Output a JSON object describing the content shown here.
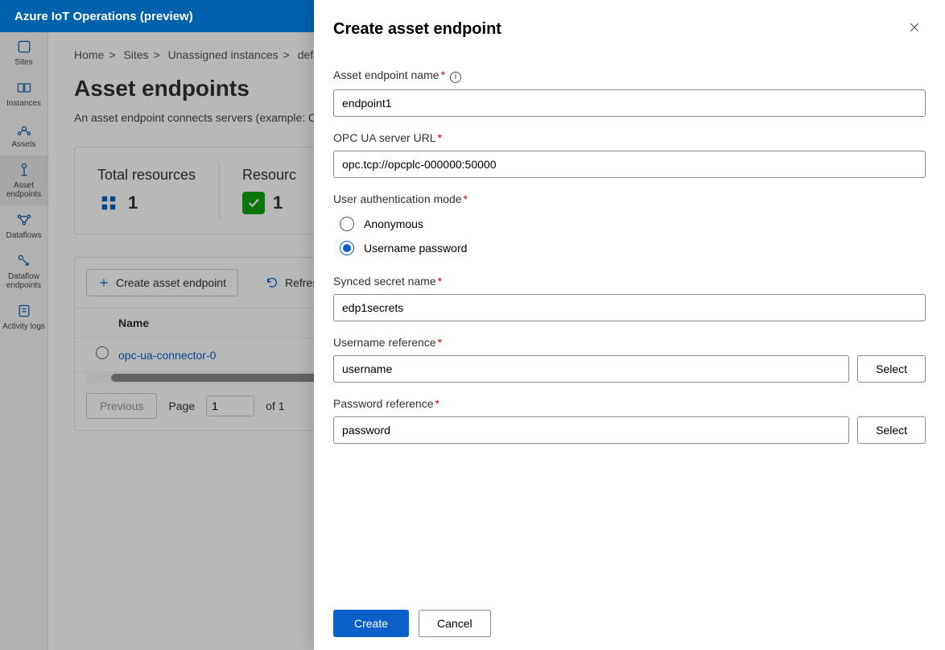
{
  "brand": "Azure IoT Operations (preview)",
  "rail": [
    {
      "id": "sites",
      "label": "Sites"
    },
    {
      "id": "instances",
      "label": "Instances"
    },
    {
      "id": "assets",
      "label": "Assets"
    },
    {
      "id": "asset-endpoints",
      "label": "Asset endpoints"
    },
    {
      "id": "dataflows",
      "label": "Dataflows"
    },
    {
      "id": "dataflow-endpoints",
      "label": "Dataflow endpoints"
    },
    {
      "id": "activity-logs",
      "label": "Activity logs"
    }
  ],
  "crumbs": [
    "Home",
    "Sites",
    "Unassigned instances",
    "default"
  ],
  "page": {
    "title": "Asset endpoints",
    "subtitle": "An asset endpoint connects servers (example: O",
    "cards": {
      "total": {
        "label": "Total resources",
        "value": "1"
      },
      "ok": {
        "label": "Resourc",
        "value": "1"
      }
    },
    "toolbar": {
      "create": "Create asset endpoint",
      "refresh": "Refres"
    },
    "table": {
      "header_name": "Name",
      "rows": [
        {
          "name": "opc-ua-connector-0"
        }
      ]
    },
    "pager": {
      "prev": "Previous",
      "page_label": "Page",
      "page": "1",
      "of": "of 1"
    }
  },
  "panel": {
    "title": "Create asset endpoint",
    "fields": {
      "name": {
        "label": "Asset endpoint name",
        "value": "endpoint1"
      },
      "url": {
        "label": "OPC UA server URL",
        "value": "opc.tcp://opcplc-000000:50000"
      },
      "auth": {
        "label": "User authentication mode",
        "options": [
          "Anonymous",
          "Username password"
        ],
        "selected": 1
      },
      "secret": {
        "label": "Synced secret name",
        "value": "edp1secrets"
      },
      "user": {
        "label": "Username reference",
        "value": "username",
        "select": "Select"
      },
      "pass": {
        "label": "Password reference",
        "value": "password",
        "select": "Select"
      }
    },
    "footer": {
      "create": "Create",
      "cancel": "Cancel"
    }
  }
}
